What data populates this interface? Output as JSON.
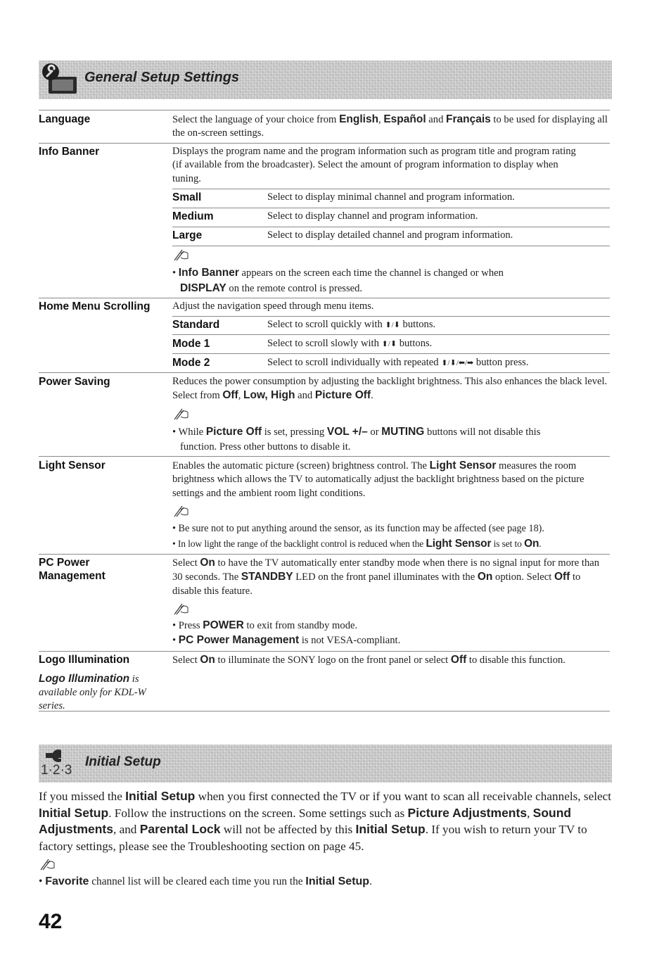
{
  "general_setup": {
    "title": "General Setup Settings",
    "icon": "wrench-tv-icon",
    "rows": {
      "language": {
        "label": "Language",
        "desc": {
          "p1": "Select the language of your choice from ",
          "b1": "English",
          "p2": ", ",
          "b2": "Español",
          "p3": " and ",
          "b3": "Français",
          "p4": " to be used for displaying all the on-screen settings."
        }
      },
      "info_banner": {
        "label": "Info Banner",
        "desc": "Displays the program name and the program information such as program title and program rating (if available from the broadcaster). Select the amount of program information to display when tuning.",
        "options": [
          {
            "label": "Small",
            "desc": "Select to display minimal channel and program information."
          },
          {
            "label": "Medium",
            "desc": "Select to display channel and program information."
          },
          {
            "label": "Large",
            "desc": "Select to display detailed channel and program information."
          }
        ],
        "note": {
          "b1": "Info Banner",
          "p1": " appears on the screen each time the channel is changed or when",
          "b2": "DISPLAY",
          "p2": " on the remote control is pressed."
        }
      },
      "home_menu_scrolling": {
        "label": "Home Menu Scrolling",
        "desc": "Adjust the navigation speed through menu items.",
        "options": [
          {
            "label": "Standard",
            "desc": "Select to scroll quickly with ⇡/⇣ buttons.",
            "text": "Select to scroll quickly with ",
            "arrows": "⬆/⬇",
            "tail": " buttons."
          },
          {
            "label": "Mode 1",
            "text": "Select to scroll slowly with ",
            "arrows": "⬆/⬇",
            "tail": " buttons."
          },
          {
            "label": "Mode 2",
            "text": "Select to scroll individually with repeated ",
            "arrows": "⬆/⬇/⬅/➡",
            "tail": " button press."
          }
        ]
      },
      "power_saving": {
        "label": "Power Saving",
        "desc": {
          "p1": "Reduces the power consumption by adjusting the backlight brightness. This also enhances the black level. Select from ",
          "b1": "Off",
          "p2": ", ",
          "b2": "Low, High",
          "p3": " and ",
          "b3": "Picture Off",
          "p4": "."
        },
        "note": {
          "p1": "While ",
          "b1": "Picture Off",
          "p2": " is set, pressing ",
          "b2": "VOL +/–",
          "p3": " or ",
          "b3": "MUTING",
          "p4": " buttons will not disable this",
          "p5": "function. Press other buttons to disable it."
        }
      },
      "light_sensor": {
        "label": "Light Sensor",
        "desc": {
          "p1": "Enables the automatic picture (screen) brightness control. The ",
          "b1": "Light Sensor",
          "p2": " measures the room brightness which allows the TV to automatically adjust the backlight brightness based on the picture settings and the ambient room light conditions."
        },
        "notes": {
          "n1": "Be sure not to put anything around the sensor, as its function may be affected (see page 18).",
          "n2_p1": "In low light the range of the backlight control is reduced when the ",
          "n2_b1": "Light Sensor",
          "n2_p2": " is set to ",
          "n2_b2": "On",
          "n2_p3": "."
        }
      },
      "pc_power_management": {
        "label_line1": "PC Power",
        "label_line2": "Management",
        "desc": {
          "p1": "Select ",
          "b1": "On",
          "p2": " to have the TV automatically enter standby mode when there is no signal input for more than 30 seconds. The ",
          "b2": "STANDBY",
          "p3": " LED on the front panel illuminates with the ",
          "b3": "On",
          "p4": " option. Select ",
          "b4": "Off",
          "p5": " to disable this feature."
        },
        "notes": {
          "n1_p1": "Press ",
          "n1_b1": "POWER",
          "n1_p2": " to exit from standby mode.",
          "n2_b1": "PC Power Management",
          "n2_p1": " is not VESA-compliant."
        }
      },
      "logo_illumination": {
        "label": "Logo Illumination",
        "side_note_bold": "Logo Illumination",
        "side_note_text": " is available only for KDL-W series.",
        "desc": {
          "p1": "Select ",
          "b1": "On",
          "p2": " to illuminate the SONY logo on the front panel or select ",
          "b2": "Off",
          "p3": " to disable this function."
        }
      }
    }
  },
  "initial_setup": {
    "title": "Initial Setup",
    "icon_label": "1·2·3",
    "icon": "wrench-icon",
    "body": {
      "p1": "If you missed the ",
      "b1": "Initial Setup",
      "p2": " when you first connected the TV or if you want to scan all receivable channels, select ",
      "b2": "Initial Setup",
      "p3": ". Follow the instructions on the screen. Some settings such as ",
      "b3": "Picture Adjustments",
      "p4": ", ",
      "b4": "Sound Adjustments",
      "p5": ", and ",
      "b5": "Parental Lock",
      "p6": " will not be affected by this ",
      "b6": "Initial Setup",
      "p7": ". If you wish to return your TV to factory settings, please see the Troubleshooting section on page 45."
    },
    "note": {
      "b1": "Favorite",
      "p1": " channel list will be cleared each time you run the ",
      "b2": "Initial Setup",
      "p2": "."
    }
  },
  "bullet": "•",
  "page_number": "42"
}
